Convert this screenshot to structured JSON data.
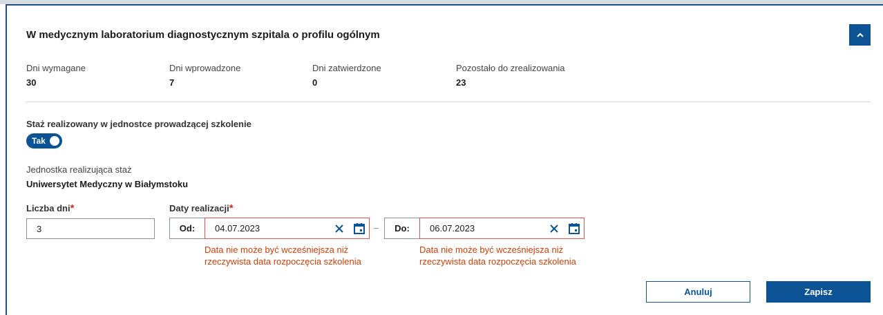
{
  "panel": {
    "title": "W medycznym laboratorium diagnostycznym szpitala o profilu ogólnym",
    "collapse_icon": "chevron-up-icon"
  },
  "stats": [
    {
      "label": "Dni wymagane",
      "value": "30"
    },
    {
      "label": "Dni wprowadzone",
      "value": "7"
    },
    {
      "label": "Dni zatwierdzone",
      "value": "0"
    },
    {
      "label": "Pozostało do zrealizowania",
      "value": "23"
    }
  ],
  "toggle": {
    "label": "Staż realizowany w jednostce prowadzącej szkolenie",
    "value_label": "Tak"
  },
  "unit": {
    "label": "Jednostka realizująca staż",
    "value": "Uniwersytet Medyczny w Białymstoku"
  },
  "form": {
    "days_label": "Liczba dni",
    "days_value": "3",
    "dates_label": "Daty realizacji",
    "required_mark": "*",
    "from_prefix": "Od:",
    "from_value": "04.07.2023",
    "to_prefix": "Do:",
    "to_value": "06.07.2023",
    "separator": "–",
    "from_error_line1": "Data nie może być wcześniejsza niż",
    "from_error_line2": "rzeczywista data rozpoczęcia szkolenia",
    "to_error_line1": "Data nie może być wcześniejsza niż",
    "to_error_line2": "rzeczywista data rozpoczęcia szkolenia"
  },
  "buttons": {
    "cancel": "Anuluj",
    "save": "Zapisz"
  },
  "colors": {
    "primary": "#0b5394",
    "error": "#c8410b",
    "required": "#d52b1e"
  }
}
